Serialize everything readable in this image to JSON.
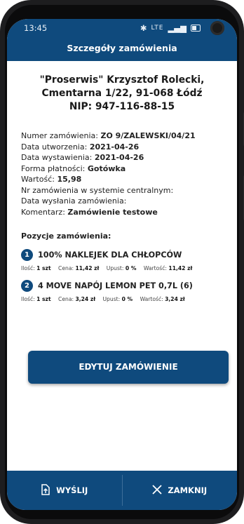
{
  "status_bar": {
    "time": "13:45",
    "signal": "LTE"
  },
  "header": {
    "title": "Szczegóły zamówienia"
  },
  "company": {
    "line1": "\"Proserwis\" Krzysztof Rolecki,",
    "line2": "Cmentarna 1/22, 91-068 Łódź",
    "line3": "NIP: 947-116-88-15"
  },
  "details": [
    {
      "label": "Numer zamówienia:",
      "value": "ZO 9/ZALEWSKI/04/21"
    },
    {
      "label": "Data utworzenia:",
      "value": "2021-04-26"
    },
    {
      "label": "Data wystawienia:",
      "value": "2021-04-26"
    },
    {
      "label": "Forma płatności:",
      "value": "Gotówka"
    },
    {
      "label": "Wartość:",
      "value": "15,98"
    },
    {
      "label": "Nr zamówienia w systemie centralnym:",
      "value": ""
    },
    {
      "label": "Data wysłania zamówienia:",
      "value": ""
    },
    {
      "label": "Komentarz:",
      "value": "Zamówienie testowe"
    }
  ],
  "positions_title": "Pozycje zamówienia:",
  "positions": [
    {
      "num": "1",
      "name": "100% NAKLEJEK DLA CHŁOPCÓW",
      "qty_label": "Ilość:",
      "qty": "1 szt",
      "price_label": "Cena:",
      "price": "11,42 zł",
      "discount_label": "Upust:",
      "discount": "0 %",
      "value_label": "Wartość:",
      "value": "11,42 zł"
    },
    {
      "num": "2",
      "name": "4 MOVE NAPÓJ LEMON PET 0,7L (6)",
      "qty_label": "Ilość:",
      "qty": "1 szt",
      "price_label": "Cena:",
      "price": "3,24 zł",
      "discount_label": "Upust:",
      "discount": "0 %",
      "value_label": "Wartość:",
      "value": "3,24 zł"
    }
  ],
  "buttons": {
    "edit": "EDYTUJ ZAMÓWIENIE",
    "send": "WYŚLIJ",
    "close": "ZAMKNIJ"
  },
  "colors": {
    "primary": "#0f4a7d",
    "background": "#ffffff"
  },
  "icons": {
    "send": "upload-file-icon",
    "close": "close-x-icon"
  }
}
